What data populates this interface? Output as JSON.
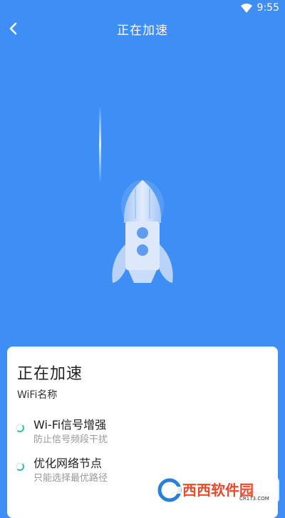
{
  "status_bar": {
    "time": "9:55",
    "wifi_icon": "wifi-icon"
  },
  "header": {
    "title": "正在加速",
    "back_icon": "chevron-left-icon"
  },
  "hero": {
    "icon": "rocket-icon",
    "colors": {
      "background": "#3f8ef6",
      "rocket": "#cfe0fb"
    }
  },
  "card": {
    "title": "正在加速",
    "wifi_name": "WiFi名称",
    "items": [
      {
        "title": "Wi-Fi信号增强",
        "subtitle": "防止信号频段干扰",
        "icon": "loading-spinner-icon"
      },
      {
        "title": "优化网络节点",
        "subtitle": "只能选择最优路径",
        "icon": "loading-spinner-icon"
      }
    ],
    "accent_color": "#33c09b"
  },
  "watermark": {
    "text": "西西软件园",
    "subtext": "CR173.COM"
  }
}
